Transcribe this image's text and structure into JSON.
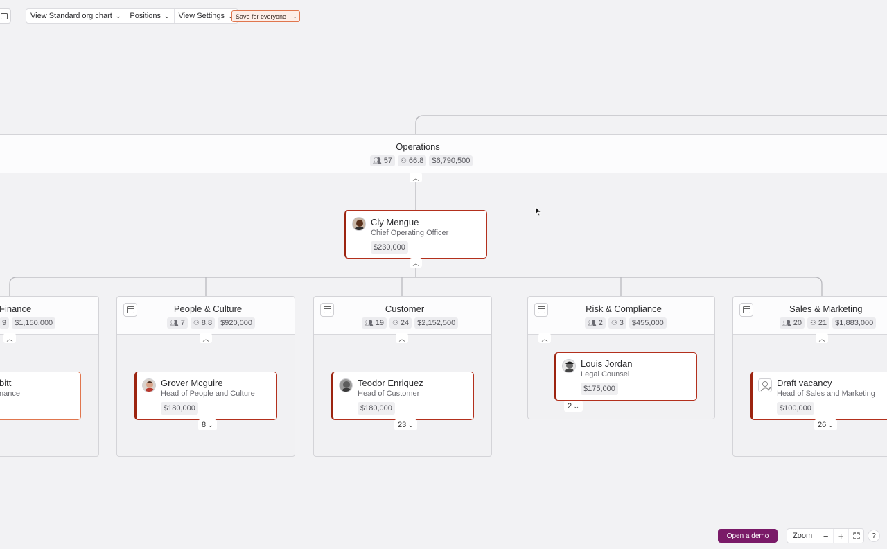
{
  "toolbar": {
    "view_chart_label": "View Standard org chart",
    "positions_label": "Positions",
    "view_settings_label": "View Settings",
    "save_label": "Save for everyone"
  },
  "operations": {
    "title": "Operations",
    "headcount": "57",
    "fte": "66.8",
    "budget": "$6,790,500"
  },
  "coo": {
    "name": "Cly Mengue",
    "role": "Chief Operating Officer",
    "salary": "$230,000"
  },
  "departments": {
    "finance": {
      "title": "Finance",
      "fte": "9",
      "budget": "$1,150,000",
      "lead_name": "bitt",
      "lead_role": "nance"
    },
    "people": {
      "title": "People & Culture",
      "headcount": "7",
      "fte": "8.8",
      "budget": "$920,000",
      "lead_name": "Grover Mcguire",
      "lead_role": "Head of People and Culture",
      "lead_salary": "$180,000",
      "reports": "8"
    },
    "customer": {
      "title": "Customer",
      "headcount": "19",
      "fte": "24",
      "budget": "$2,152,500",
      "lead_name": "Teodor Enriquez",
      "lead_role": "Head of Customer",
      "lead_salary": "$180,000",
      "reports": "23"
    },
    "risk": {
      "title": "Risk & Compliance",
      "headcount": "2",
      "fte": "3",
      "budget": "$455,000",
      "lead_name": "Louis Jordan",
      "lead_role": "Legal Counsel",
      "lead_salary": "$175,000",
      "reports": "2"
    },
    "sales": {
      "title": "Sales & Marketing",
      "headcount": "20",
      "fte": "21",
      "budget": "$1,883,000",
      "lead_name": "Draft vacancy",
      "lead_role": "Head of Sales and Marketing",
      "lead_salary": "$100,000",
      "reports": "26"
    }
  },
  "footer": {
    "demo_label": "Open a demo",
    "zoom_label": "Zoom",
    "zoom_out": "−",
    "zoom_in": "+",
    "help": "?"
  },
  "icons": {
    "chevron_up": "^",
    "chevron_down": "v"
  }
}
